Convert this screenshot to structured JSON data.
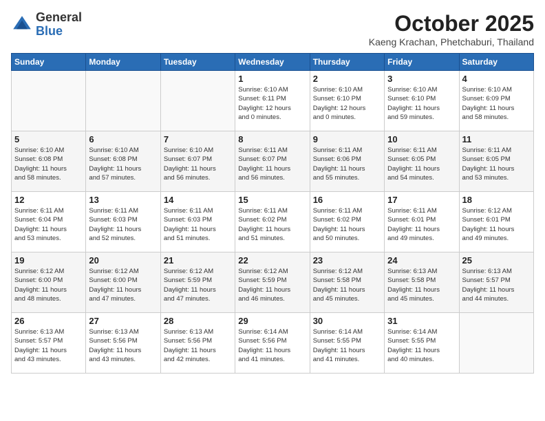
{
  "header": {
    "logo_general": "General",
    "logo_blue": "Blue",
    "month": "October 2025",
    "location": "Kaeng Krachan, Phetchaburi, Thailand"
  },
  "days_of_week": [
    "Sunday",
    "Monday",
    "Tuesday",
    "Wednesday",
    "Thursday",
    "Friday",
    "Saturday"
  ],
  "weeks": [
    [
      {
        "day": "",
        "info": ""
      },
      {
        "day": "",
        "info": ""
      },
      {
        "day": "",
        "info": ""
      },
      {
        "day": "1",
        "info": "Sunrise: 6:10 AM\nSunset: 6:11 PM\nDaylight: 12 hours\nand 0 minutes."
      },
      {
        "day": "2",
        "info": "Sunrise: 6:10 AM\nSunset: 6:10 PM\nDaylight: 12 hours\nand 0 minutes."
      },
      {
        "day": "3",
        "info": "Sunrise: 6:10 AM\nSunset: 6:10 PM\nDaylight: 11 hours\nand 59 minutes."
      },
      {
        "day": "4",
        "info": "Sunrise: 6:10 AM\nSunset: 6:09 PM\nDaylight: 11 hours\nand 58 minutes."
      }
    ],
    [
      {
        "day": "5",
        "info": "Sunrise: 6:10 AM\nSunset: 6:08 PM\nDaylight: 11 hours\nand 58 minutes."
      },
      {
        "day": "6",
        "info": "Sunrise: 6:10 AM\nSunset: 6:08 PM\nDaylight: 11 hours\nand 57 minutes."
      },
      {
        "day": "7",
        "info": "Sunrise: 6:10 AM\nSunset: 6:07 PM\nDaylight: 11 hours\nand 56 minutes."
      },
      {
        "day": "8",
        "info": "Sunrise: 6:11 AM\nSunset: 6:07 PM\nDaylight: 11 hours\nand 56 minutes."
      },
      {
        "day": "9",
        "info": "Sunrise: 6:11 AM\nSunset: 6:06 PM\nDaylight: 11 hours\nand 55 minutes."
      },
      {
        "day": "10",
        "info": "Sunrise: 6:11 AM\nSunset: 6:05 PM\nDaylight: 11 hours\nand 54 minutes."
      },
      {
        "day": "11",
        "info": "Sunrise: 6:11 AM\nSunset: 6:05 PM\nDaylight: 11 hours\nand 53 minutes."
      }
    ],
    [
      {
        "day": "12",
        "info": "Sunrise: 6:11 AM\nSunset: 6:04 PM\nDaylight: 11 hours\nand 53 minutes."
      },
      {
        "day": "13",
        "info": "Sunrise: 6:11 AM\nSunset: 6:03 PM\nDaylight: 11 hours\nand 52 minutes."
      },
      {
        "day": "14",
        "info": "Sunrise: 6:11 AM\nSunset: 6:03 PM\nDaylight: 11 hours\nand 51 minutes."
      },
      {
        "day": "15",
        "info": "Sunrise: 6:11 AM\nSunset: 6:02 PM\nDaylight: 11 hours\nand 51 minutes."
      },
      {
        "day": "16",
        "info": "Sunrise: 6:11 AM\nSunset: 6:02 PM\nDaylight: 11 hours\nand 50 minutes."
      },
      {
        "day": "17",
        "info": "Sunrise: 6:11 AM\nSunset: 6:01 PM\nDaylight: 11 hours\nand 49 minutes."
      },
      {
        "day": "18",
        "info": "Sunrise: 6:12 AM\nSunset: 6:01 PM\nDaylight: 11 hours\nand 49 minutes."
      }
    ],
    [
      {
        "day": "19",
        "info": "Sunrise: 6:12 AM\nSunset: 6:00 PM\nDaylight: 11 hours\nand 48 minutes."
      },
      {
        "day": "20",
        "info": "Sunrise: 6:12 AM\nSunset: 6:00 PM\nDaylight: 11 hours\nand 47 minutes."
      },
      {
        "day": "21",
        "info": "Sunrise: 6:12 AM\nSunset: 5:59 PM\nDaylight: 11 hours\nand 47 minutes."
      },
      {
        "day": "22",
        "info": "Sunrise: 6:12 AM\nSunset: 5:59 PM\nDaylight: 11 hours\nand 46 minutes."
      },
      {
        "day": "23",
        "info": "Sunrise: 6:12 AM\nSunset: 5:58 PM\nDaylight: 11 hours\nand 45 minutes."
      },
      {
        "day": "24",
        "info": "Sunrise: 6:13 AM\nSunset: 5:58 PM\nDaylight: 11 hours\nand 45 minutes."
      },
      {
        "day": "25",
        "info": "Sunrise: 6:13 AM\nSunset: 5:57 PM\nDaylight: 11 hours\nand 44 minutes."
      }
    ],
    [
      {
        "day": "26",
        "info": "Sunrise: 6:13 AM\nSunset: 5:57 PM\nDaylight: 11 hours\nand 43 minutes."
      },
      {
        "day": "27",
        "info": "Sunrise: 6:13 AM\nSunset: 5:56 PM\nDaylight: 11 hours\nand 43 minutes."
      },
      {
        "day": "28",
        "info": "Sunrise: 6:13 AM\nSunset: 5:56 PM\nDaylight: 11 hours\nand 42 minutes."
      },
      {
        "day": "29",
        "info": "Sunrise: 6:14 AM\nSunset: 5:56 PM\nDaylight: 11 hours\nand 41 minutes."
      },
      {
        "day": "30",
        "info": "Sunrise: 6:14 AM\nSunset: 5:55 PM\nDaylight: 11 hours\nand 41 minutes."
      },
      {
        "day": "31",
        "info": "Sunrise: 6:14 AM\nSunset: 5:55 PM\nDaylight: 11 hours\nand 40 minutes."
      },
      {
        "day": "",
        "info": ""
      }
    ]
  ]
}
